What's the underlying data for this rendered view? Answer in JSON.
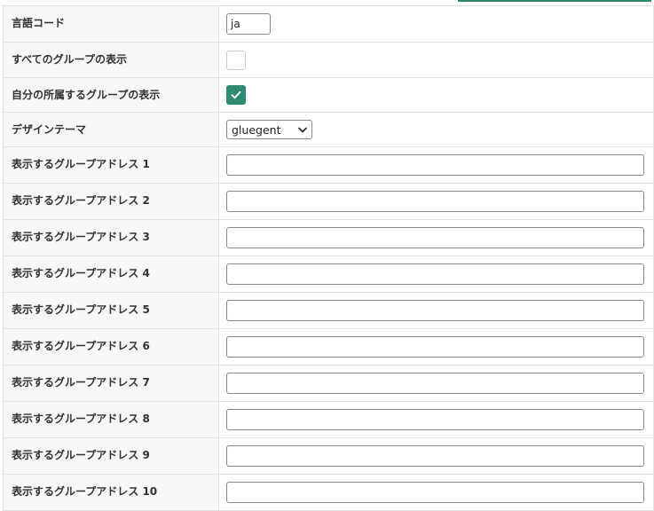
{
  "rows": [
    {
      "label": "言語コード",
      "type": "text-short",
      "value": "ja"
    },
    {
      "label": "すべてのグループの表示",
      "type": "checkbox",
      "checked": false
    },
    {
      "label": "自分の所属するグループの表示",
      "type": "checkbox",
      "checked": true
    },
    {
      "label": "デザインテーマ",
      "type": "select",
      "value": "gluegent"
    },
    {
      "label": "表示するグループアドレス 1",
      "type": "text",
      "value": ""
    },
    {
      "label": "表示するグループアドレス 2",
      "type": "text",
      "value": ""
    },
    {
      "label": "表示するグループアドレス 3",
      "type": "text",
      "value": ""
    },
    {
      "label": "表示するグループアドレス 4",
      "type": "text",
      "value": ""
    },
    {
      "label": "表示するグループアドレス 5",
      "type": "text",
      "value": ""
    },
    {
      "label": "表示するグループアドレス 6",
      "type": "text",
      "value": ""
    },
    {
      "label": "表示するグループアドレス 7",
      "type": "text",
      "value": ""
    },
    {
      "label": "表示するグループアドレス 8",
      "type": "text",
      "value": ""
    },
    {
      "label": "表示するグループアドレス 9",
      "type": "text",
      "value": ""
    },
    {
      "label": "表示するグループアドレス 10",
      "type": "text",
      "value": ""
    }
  ],
  "colors": {
    "accent": "#2e8b72",
    "label_bg": "#f7f7f7",
    "border": "#e3e3e3"
  }
}
